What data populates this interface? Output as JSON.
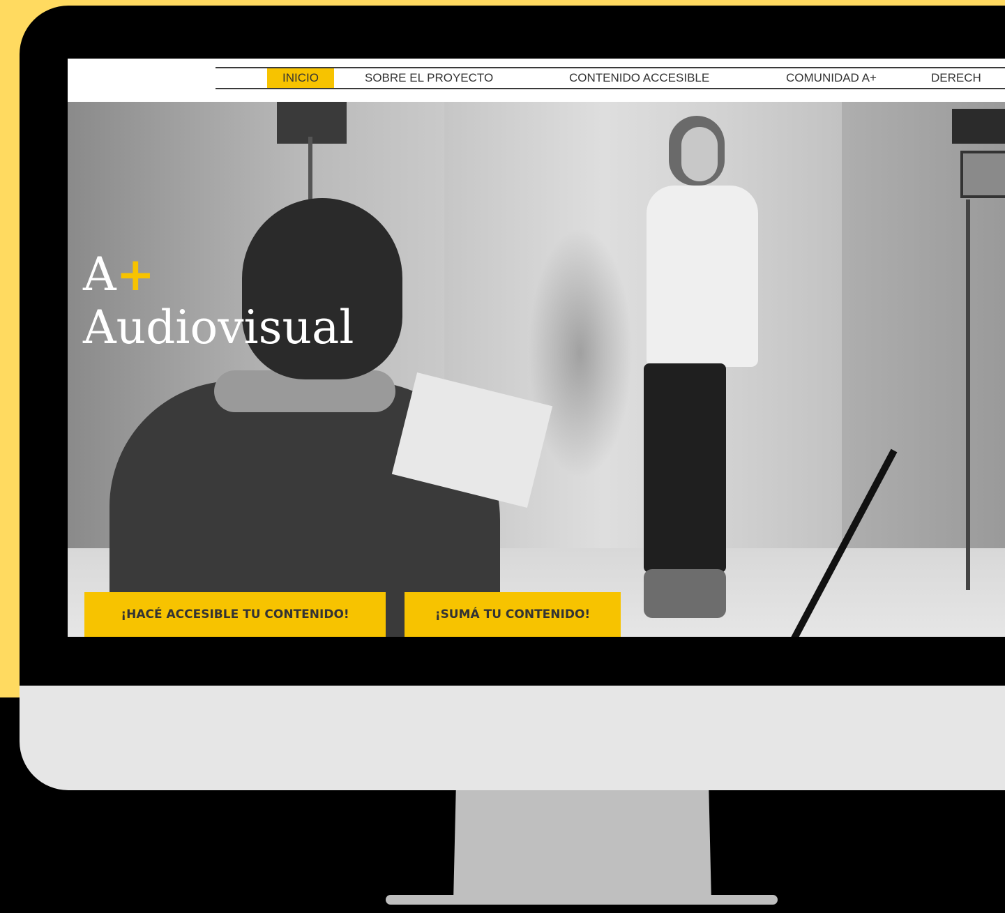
{
  "nav": {
    "items": [
      {
        "label": "INICIO",
        "active": true
      },
      {
        "label": "SOBRE EL PROYECTO"
      },
      {
        "label": "CONTENIDO ACCESIBLE"
      },
      {
        "label": "COMUNIDAD A+"
      },
      {
        "label": "DERECH"
      }
    ]
  },
  "hero": {
    "brand_line1": "A",
    "brand_plus": "+",
    "brand_line2": "Audiovisual"
  },
  "cta": {
    "primary_label": "¡HACÉ ACCESIBLE TU CONTENIDO!",
    "secondary_label": "¡SUMÁ TU CONTENIDO!"
  },
  "colors": {
    "accent": "#F7C300",
    "background": "#FFDA60",
    "monitor_bezel": "#000000",
    "monitor_chin": "#E6E6E6",
    "monitor_stand": "#BFBFBF"
  }
}
